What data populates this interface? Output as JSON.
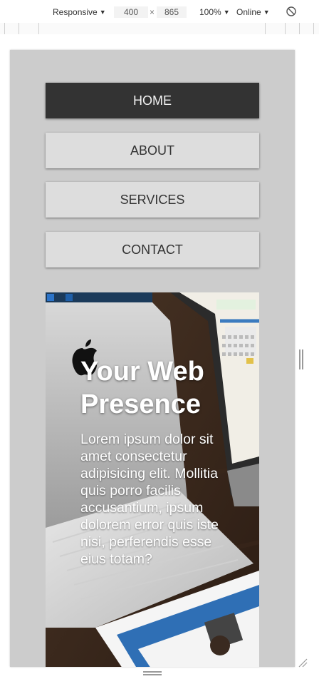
{
  "devtools": {
    "device": "Responsive",
    "width": "400",
    "times": "×",
    "height": "865",
    "zoom": "100%",
    "network": "Online",
    "rotate_icon": "rotate-icon"
  },
  "nav": {
    "items": [
      {
        "label": "HOME",
        "active": true
      },
      {
        "label": "ABOUT",
        "active": false
      },
      {
        "label": "SERVICES",
        "active": false
      },
      {
        "label": "CONTACT",
        "active": false
      }
    ]
  },
  "hero": {
    "title": "Your Web Presence",
    "text": "Lorem ipsum dolor sit amet consectetur adipisicing elit. Mollitia quis porro facilis accusantium, ipsum dolorem error quis iste nisi, perferendis esse eius totam?"
  },
  "colors": {
    "nav_active_bg": "#333333",
    "nav_bg": "#dddddd",
    "page_bg": "#cccccc"
  }
}
